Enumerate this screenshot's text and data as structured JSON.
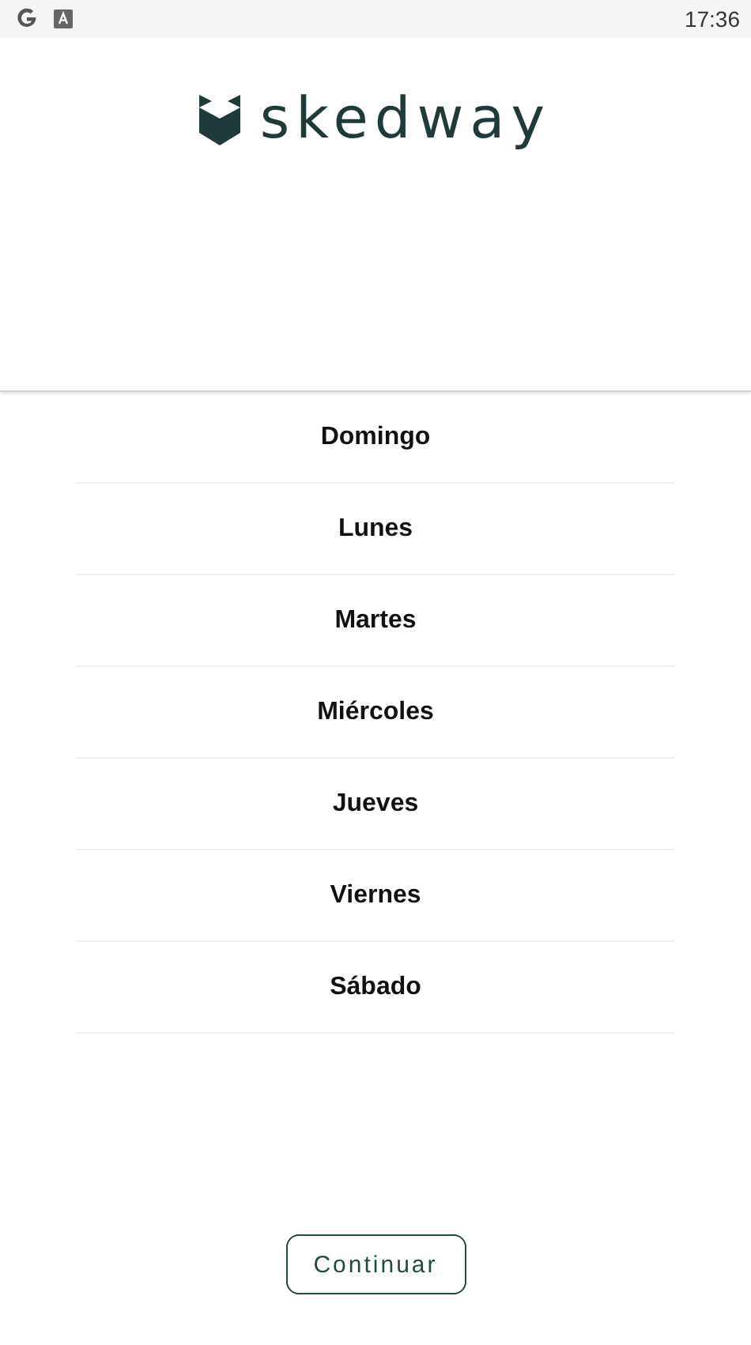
{
  "status_bar": {
    "time": "17:36"
  },
  "header": {
    "logo_text": "skedway"
  },
  "days": [
    {
      "label": "Domingo"
    },
    {
      "label": "Lunes"
    },
    {
      "label": "Martes"
    },
    {
      "label": "Miércoles"
    },
    {
      "label": "Jueves"
    },
    {
      "label": "Viernes"
    },
    {
      "label": "Sábado"
    }
  ],
  "button": {
    "label": "Continuar"
  }
}
